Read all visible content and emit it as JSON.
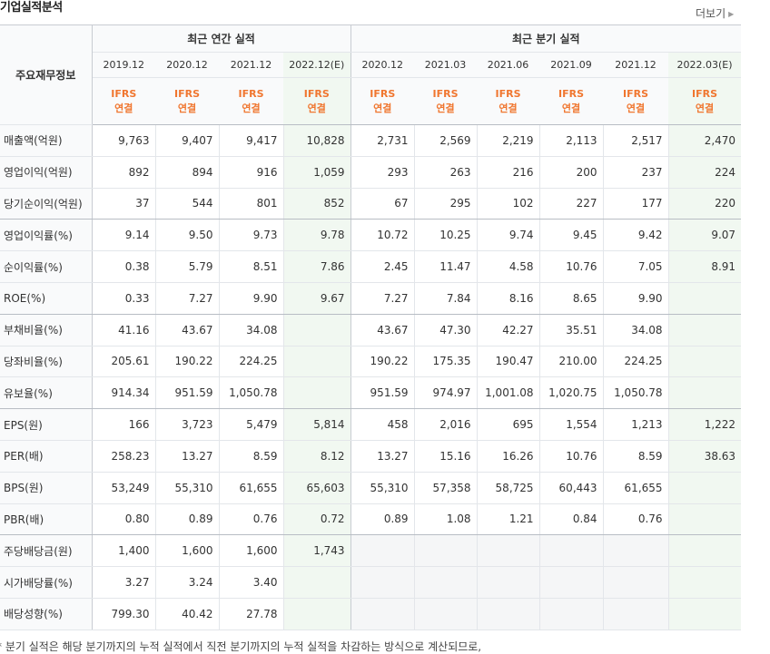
{
  "title": "기업실적분석",
  "more_label": "더보기",
  "header": {
    "metric_label": "주요재무정보",
    "annual_group": "최근 연간 실적",
    "quarter_group": "최근 분기 실적",
    "annual_periods": [
      "2019.12",
      "2020.12",
      "2021.12",
      "2022.12(E)"
    ],
    "quarter_periods": [
      "2020.12",
      "2021.03",
      "2021.06",
      "2021.09",
      "2021.12",
      "2022.03(E)"
    ],
    "ifrs_top": "IFRS",
    "ifrs_bottom": "연결"
  },
  "rows": [
    {
      "label": "매출액(억원)",
      "annual": [
        "9,763",
        "9,407",
        "9,417",
        "10,828"
      ],
      "quarter": [
        "2,731",
        "2,569",
        "2,219",
        "2,113",
        "2,517",
        "2,470"
      ]
    },
    {
      "label": "영업이익(억원)",
      "annual": [
        "892",
        "894",
        "916",
        "1,059"
      ],
      "quarter": [
        "293",
        "263",
        "216",
        "200",
        "237",
        "224"
      ]
    },
    {
      "label": "당기순이익(억원)",
      "annual": [
        "37",
        "544",
        "801",
        "852"
      ],
      "quarter": [
        "67",
        "295",
        "102",
        "227",
        "177",
        "220"
      ]
    },
    {
      "label": "영업이익률(%)",
      "annual": [
        "9.14",
        "9.50",
        "9.73",
        "9.78"
      ],
      "quarter": [
        "10.72",
        "10.25",
        "9.74",
        "9.45",
        "9.42",
        "9.07"
      ]
    },
    {
      "label": "순이익률(%)",
      "annual": [
        "0.38",
        "5.79",
        "8.51",
        "7.86"
      ],
      "quarter": [
        "2.45",
        "11.47",
        "4.58",
        "10.76",
        "7.05",
        "8.91"
      ]
    },
    {
      "label": "ROE(%)",
      "annual": [
        "0.33",
        "7.27",
        "9.90",
        "9.67"
      ],
      "quarter": [
        "7.27",
        "7.84",
        "8.16",
        "8.65",
        "9.90",
        ""
      ]
    },
    {
      "label": "부채비율(%)",
      "annual": [
        "41.16",
        "43.67",
        "34.08",
        ""
      ],
      "quarter": [
        "43.67",
        "47.30",
        "42.27",
        "35.51",
        "34.08",
        ""
      ]
    },
    {
      "label": "당좌비율(%)",
      "annual": [
        "205.61",
        "190.22",
        "224.25",
        ""
      ],
      "quarter": [
        "190.22",
        "175.35",
        "190.47",
        "210.00",
        "224.25",
        ""
      ]
    },
    {
      "label": "유보율(%)",
      "annual": [
        "914.34",
        "951.59",
        "1,050.78",
        ""
      ],
      "quarter": [
        "951.59",
        "974.97",
        "1,001.08",
        "1,020.75",
        "1,050.78",
        ""
      ]
    },
    {
      "label": "EPS(원)",
      "annual": [
        "166",
        "3,723",
        "5,479",
        "5,814"
      ],
      "quarter": [
        "458",
        "2,016",
        "695",
        "1,554",
        "1,213",
        "1,222"
      ]
    },
    {
      "label": "PER(배)",
      "annual": [
        "258.23",
        "13.27",
        "8.59",
        "8.12"
      ],
      "quarter": [
        "13.27",
        "15.16",
        "16.26",
        "10.76",
        "8.59",
        "38.63"
      ]
    },
    {
      "label": "BPS(원)",
      "annual": [
        "53,249",
        "55,310",
        "61,655",
        "65,603"
      ],
      "quarter": [
        "55,310",
        "57,358",
        "58,725",
        "60,443",
        "61,655",
        ""
      ]
    },
    {
      "label": "PBR(배)",
      "annual": [
        "0.80",
        "0.89",
        "0.76",
        "0.72"
      ],
      "quarter": [
        "0.89",
        "1.08",
        "1.21",
        "0.84",
        "0.76",
        ""
      ]
    },
    {
      "label": "주당배당금(원)",
      "annual": [
        "1,400",
        "1,600",
        "1,600",
        "1,743"
      ],
      "quarter": [
        "",
        "",
        "",
        "",
        "",
        ""
      ]
    },
    {
      "label": "시가배당률(%)",
      "annual": [
        "3.27",
        "3.24",
        "3.40",
        ""
      ],
      "quarter": [
        "",
        "",
        "",
        "",
        "",
        ""
      ]
    },
    {
      "label": "배당성향(%)",
      "annual": [
        "799.30",
        "40.42",
        "27.78",
        ""
      ],
      "quarter": [
        "",
        "",
        "",
        "",
        "",
        ""
      ]
    }
  ],
  "footnote": "* 분기 실적은 해당 분기까지의 누적 실적에서 직전 분기까지의 누적 실적을 차감하는 방식으로 계산되므로,"
}
